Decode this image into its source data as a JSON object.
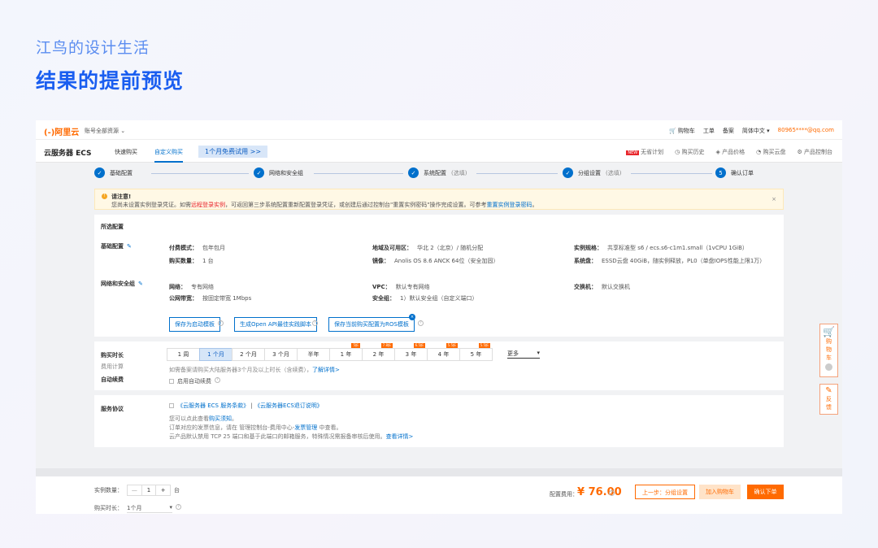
{
  "header": {
    "subtitle": "江鸟的设计生活",
    "title": "结果的提前预览"
  },
  "topbar": {
    "logo": "(-)阿里云",
    "account": "账号全部资源 ⌄",
    "items": [
      "购物车",
      "工单",
      "备案",
      "简体中文 ▾"
    ],
    "email": "80965****@qq.com"
  },
  "nav": {
    "product": "云服务器 ECS",
    "tabs": [
      "快速购买",
      "自定义购买"
    ],
    "trial": "1个月免费试用 >>",
    "right": [
      "无省计划",
      "购买历史",
      "产品价格",
      "购买云盘",
      "产品控制台"
    ],
    "new_tag": "NEW"
  },
  "steps": [
    {
      "num": "✓",
      "label": "基础配置",
      "opt": ""
    },
    {
      "num": "✓",
      "label": "网络和安全组",
      "opt": ""
    },
    {
      "num": "✓",
      "label": "系统配置",
      "opt": "(选填)"
    },
    {
      "num": "✓",
      "label": "分组设置",
      "opt": "(选填)"
    },
    {
      "num": "5",
      "label": "确认订单",
      "opt": ""
    }
  ],
  "notice": {
    "title": "请注意!",
    "pre": "您尚未设置实例登录凭证。如需",
    "link_red": "远程登录实例",
    "mid": "，可返回第三步系统配置重新配置登录凭证，或创建后通过控制台\"重置实例密码\"操作完成设置。可参考",
    "link_blue": "重置实例登录密码",
    "end": "。",
    "close": "×"
  },
  "summary": {
    "title": "所选配置",
    "basic_label": "基础配置",
    "net_label": "网络和安全组",
    "basic": [
      {
        "k": "付费模式：",
        "v": "包年包月"
      },
      {
        "k": "地域及可用区：",
        "v": "华北 2（北京）/ 随机分配"
      },
      {
        "k": "实例规格：",
        "v": "共享标准型 s6 / ecs.s6-c1m1.small（1vCPU 1GiB）"
      },
      {
        "k": "购买数量：",
        "v": "1 台"
      },
      {
        "k": "镜像：",
        "v": "Anolis OS 8.6 ANCK 64位（安全加固）"
      },
      {
        "k": "系统盘：",
        "v": "ESSD云盘 40GiB，随实例释放，PL0（单盘IOPS性能上限1万）"
      }
    ],
    "net": [
      {
        "k": "网络：",
        "v": "专有网络"
      },
      {
        "k": "VPC：",
        "v": "默认专有网络"
      },
      {
        "k": "交换机：",
        "v": "默认交换机"
      },
      {
        "k": "公网带宽：",
        "v": "按固定带宽 1Mbps"
      },
      {
        "k": "安全组：",
        "v": "1）默认安全组（自定义端口）"
      }
    ],
    "buttons": [
      "保存为启动模板",
      "生成Open API最佳实践脚本",
      "保存当前购买配置为ROS模板"
    ]
  },
  "duration": {
    "label": "购买时长",
    "sub": "费用计算",
    "options": [
      {
        "label": "1 周",
        "disc": ""
      },
      {
        "label": "1 个月",
        "disc": ""
      },
      {
        "label": "2 个月",
        "disc": ""
      },
      {
        "label": "3 个月",
        "disc": ""
      },
      {
        "label": "半年",
        "disc": ""
      },
      {
        "label": "1 年",
        "disc": "5折"
      },
      {
        "label": "2 年",
        "disc": "7.8折"
      },
      {
        "label": "3 年",
        "disc": "6.5折"
      },
      {
        "label": "4 年",
        "disc": "5.5折"
      },
      {
        "label": "5 年",
        "disc": "5.5折"
      }
    ],
    "more": "更多",
    "hint": "如需备案请购买大陆服务器3个月及以上时长（含续费），",
    "hint_link": "了解详情>",
    "auto_label": "自动续费",
    "auto_check": "启用自动续费"
  },
  "agreement": {
    "label": "服务协议",
    "docs_a": "《云服务器 ECS 服务条款》",
    "docs_sep": " | ",
    "docs_b": "《云服务器ECS退订说明》",
    "line1_pre": "您可以点此查看",
    "line1_link": "购买须知",
    "line1_end": "。",
    "line2_pre": "订单对应的发票信息，请在 管理控制台-费用中心-",
    "line2_link": "发票管理",
    "line2_end": " 中查看。",
    "line3_pre": "云产品默认禁用 TCP 25 端口和基于此端口的邮箱服务，特殊情况需报备审核后使用。",
    "line3_link": "查看详情>"
  },
  "footer": {
    "qty_label": "实例数量：",
    "qty_minus": "—",
    "qty_value": "1",
    "qty_plus": "+",
    "qty_unit": "台",
    "dur_label": "购买时长：",
    "dur_value": "1个月",
    "cost_label": "配置费用：",
    "price": "¥ 76.00",
    "prev": "上一步：分组设置",
    "cart": "加入购物车",
    "order": "确认下单"
  },
  "sidebar": {
    "cart": [
      "购",
      "物",
      "车"
    ],
    "feedback": [
      "反",
      "馈"
    ]
  }
}
